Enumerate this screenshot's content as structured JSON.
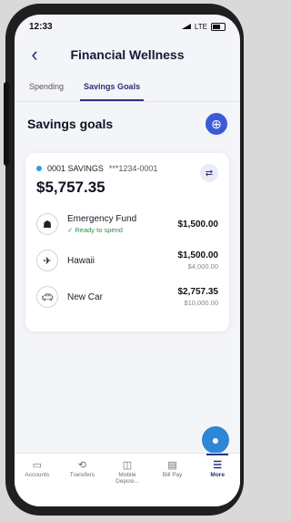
{
  "status": {
    "time": "12:33",
    "network": "LTE"
  },
  "header": {
    "title": "Financial Wellness"
  },
  "tabs": [
    {
      "label": "Spending"
    },
    {
      "label": "Savings Goals"
    }
  ],
  "section": {
    "title": "Savings goals"
  },
  "account": {
    "name": "0001 SAVINGS",
    "mask": "***1234-0001",
    "balance": "$5,757.35"
  },
  "goals": [
    {
      "name": "Emergency Fund",
      "status": "Ready to spend",
      "amount": "$1,500.00",
      "target": ""
    },
    {
      "name": "Hawaii",
      "status": "",
      "amount": "$1,500.00",
      "target": "$4,000.00"
    },
    {
      "name": "New Car",
      "status": "",
      "amount": "$2,757.35",
      "target": "$10,000.00"
    }
  ],
  "nav": [
    {
      "label": "Accounts"
    },
    {
      "label": "Transfers"
    },
    {
      "label": "Mobile Deposi..."
    },
    {
      "label": "Bill Pay"
    },
    {
      "label": "More"
    }
  ]
}
